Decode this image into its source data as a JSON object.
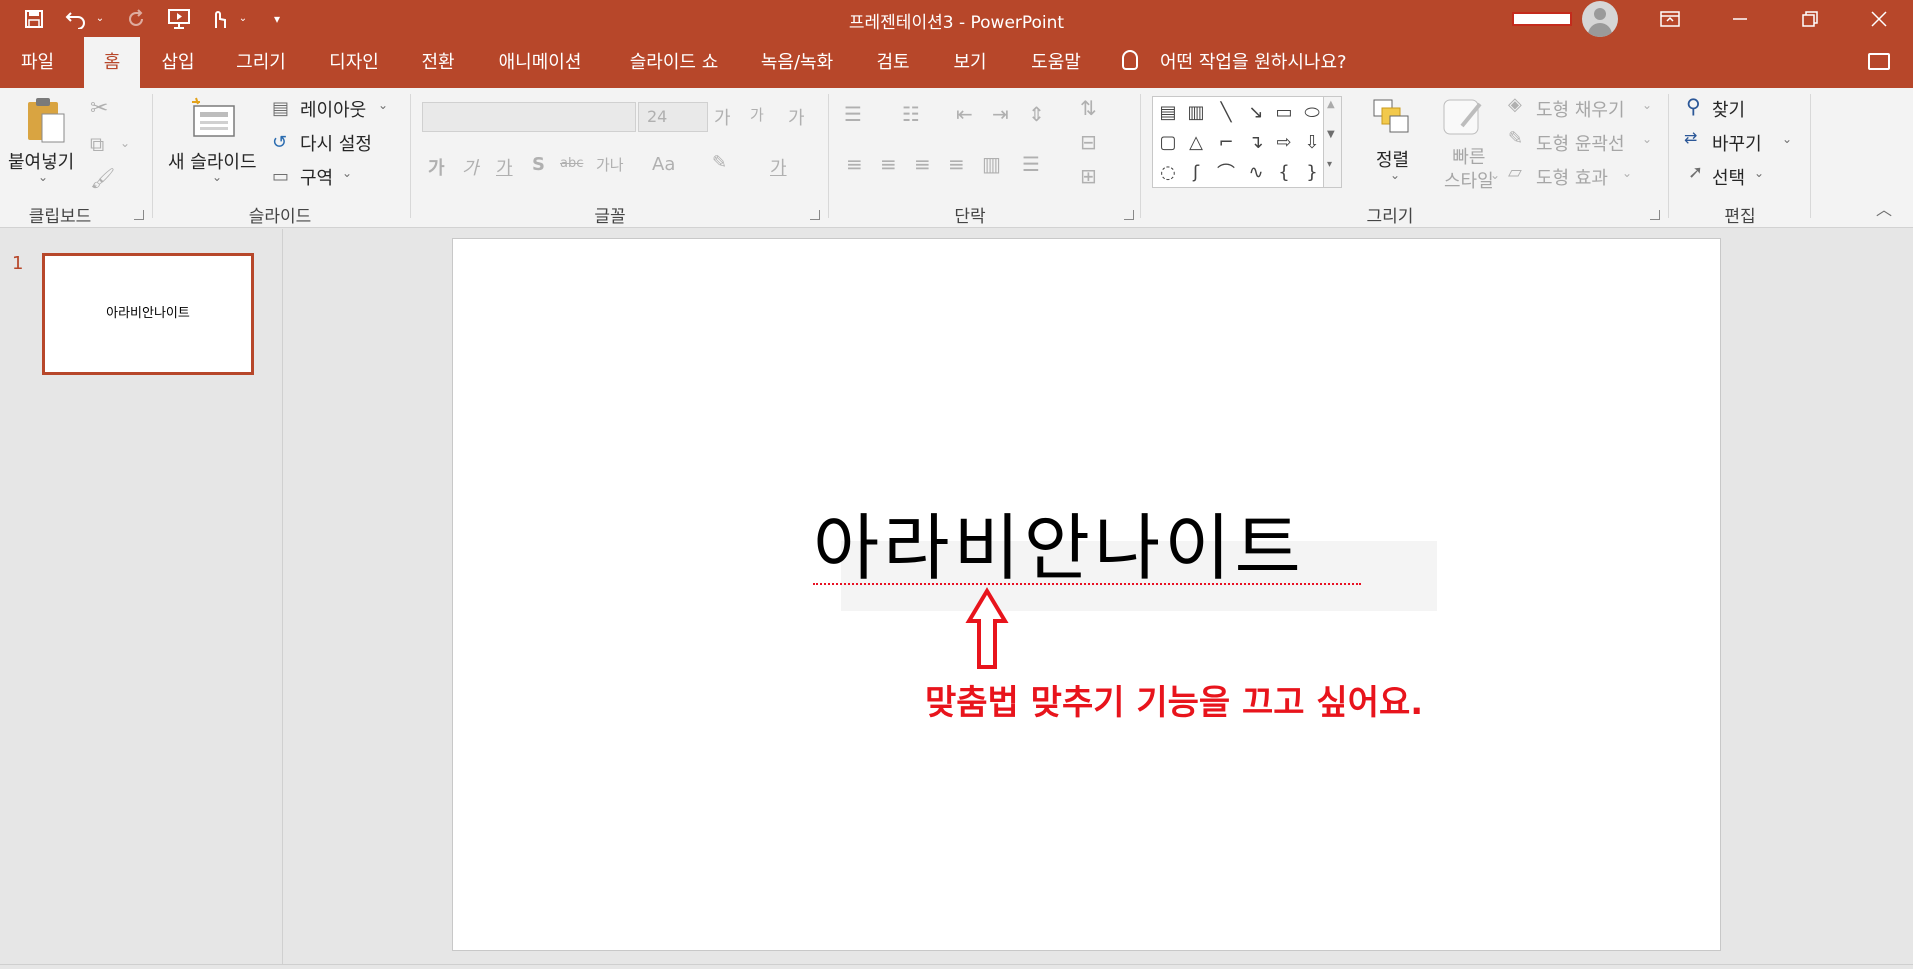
{
  "window": {
    "title": "프레젠테이션3  -  PowerPoint",
    "accent": "#b7472a"
  },
  "qat": {
    "save_icon": "save-icon",
    "undo_icon": "undo-icon",
    "redo_icon": "redo-icon",
    "present_icon": "present-icon",
    "touch_icon": "touch-mode-icon",
    "customize_icon": "customize-icon"
  },
  "tabs": [
    {
      "label": "파일"
    },
    {
      "label": "홈"
    },
    {
      "label": "삽입"
    },
    {
      "label": "그리기"
    },
    {
      "label": "디자인"
    },
    {
      "label": "전환"
    },
    {
      "label": "애니메이션"
    },
    {
      "label": "슬라이드 쇼"
    },
    {
      "label": "녹음/녹화"
    },
    {
      "label": "검토"
    },
    {
      "label": "보기"
    },
    {
      "label": "도움말"
    }
  ],
  "tellme": "어떤 작업을 원하시나요?",
  "ribbon": {
    "clipboard": {
      "paste": "붙여넣기",
      "group": "클립보드"
    },
    "slides": {
      "new_slide": "새 슬라이드",
      "layout": "레이아웃",
      "reset": "다시 설정",
      "section": "구역",
      "group": "슬라이드"
    },
    "font": {
      "size": "24",
      "bold": "가",
      "italic": "가",
      "underline": "가",
      "shadow": "S",
      "strike": "abc",
      "spacing": "가나",
      "case": "Aa",
      "grow": "가",
      "shrink": "가",
      "clear": "가",
      "color": "가",
      "group": "글꼴"
    },
    "paragraph": {
      "group": "단락"
    },
    "drawing": {
      "arrange": "정렬",
      "quick_styles": "빠른\n스타일",
      "fill": "도형 채우기",
      "outline": "도형 윤곽선",
      "effects": "도형 효과",
      "group": "그리기",
      "shapes_row3": [
        "{",
        "}"
      ]
    },
    "editing": {
      "find": "찾기",
      "replace": "바꾸기",
      "select": "선택",
      "group": "편집"
    }
  },
  "thumbnails": [
    {
      "number": "1",
      "text": "아라비안나이트"
    }
  ],
  "slide": {
    "title": "아라비안나이트",
    "annotation": "맞춤법 맞추기 기능을 끄고 싶어요.",
    "annotation_color": "#e8141c"
  }
}
